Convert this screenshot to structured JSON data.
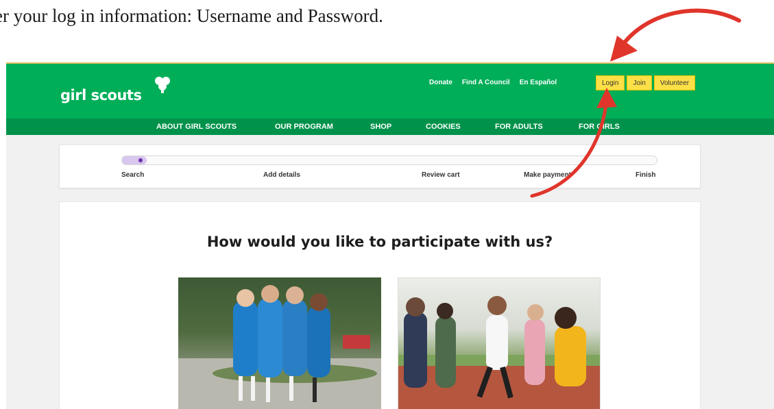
{
  "caption": "er your log in information: Username and Password.",
  "header": {
    "logo_text": "girl scouts",
    "util_links": [
      "Donate",
      "Find A Council",
      "En Español"
    ],
    "auth_buttons": [
      "Login",
      "Join",
      "Volunteer"
    ]
  },
  "nav": {
    "items": [
      "ABOUT GIRL SCOUTS",
      "OUR PROGRAM",
      "SHOP",
      "COOKIES",
      "FOR ADULTS",
      "FOR GIRLS"
    ]
  },
  "progress": {
    "steps": [
      "Search",
      "Add details",
      "Review cart",
      "Make payment",
      "Finish"
    ],
    "current_step": 1
  },
  "main": {
    "headline": "How would you like to participate with us?"
  },
  "colors": {
    "brand_green": "#00ae58",
    "nav_green": "#00924a",
    "button_yellow": "#fde047",
    "progress_purple": "#6b2fa8",
    "annotation_red": "#e0352b"
  }
}
